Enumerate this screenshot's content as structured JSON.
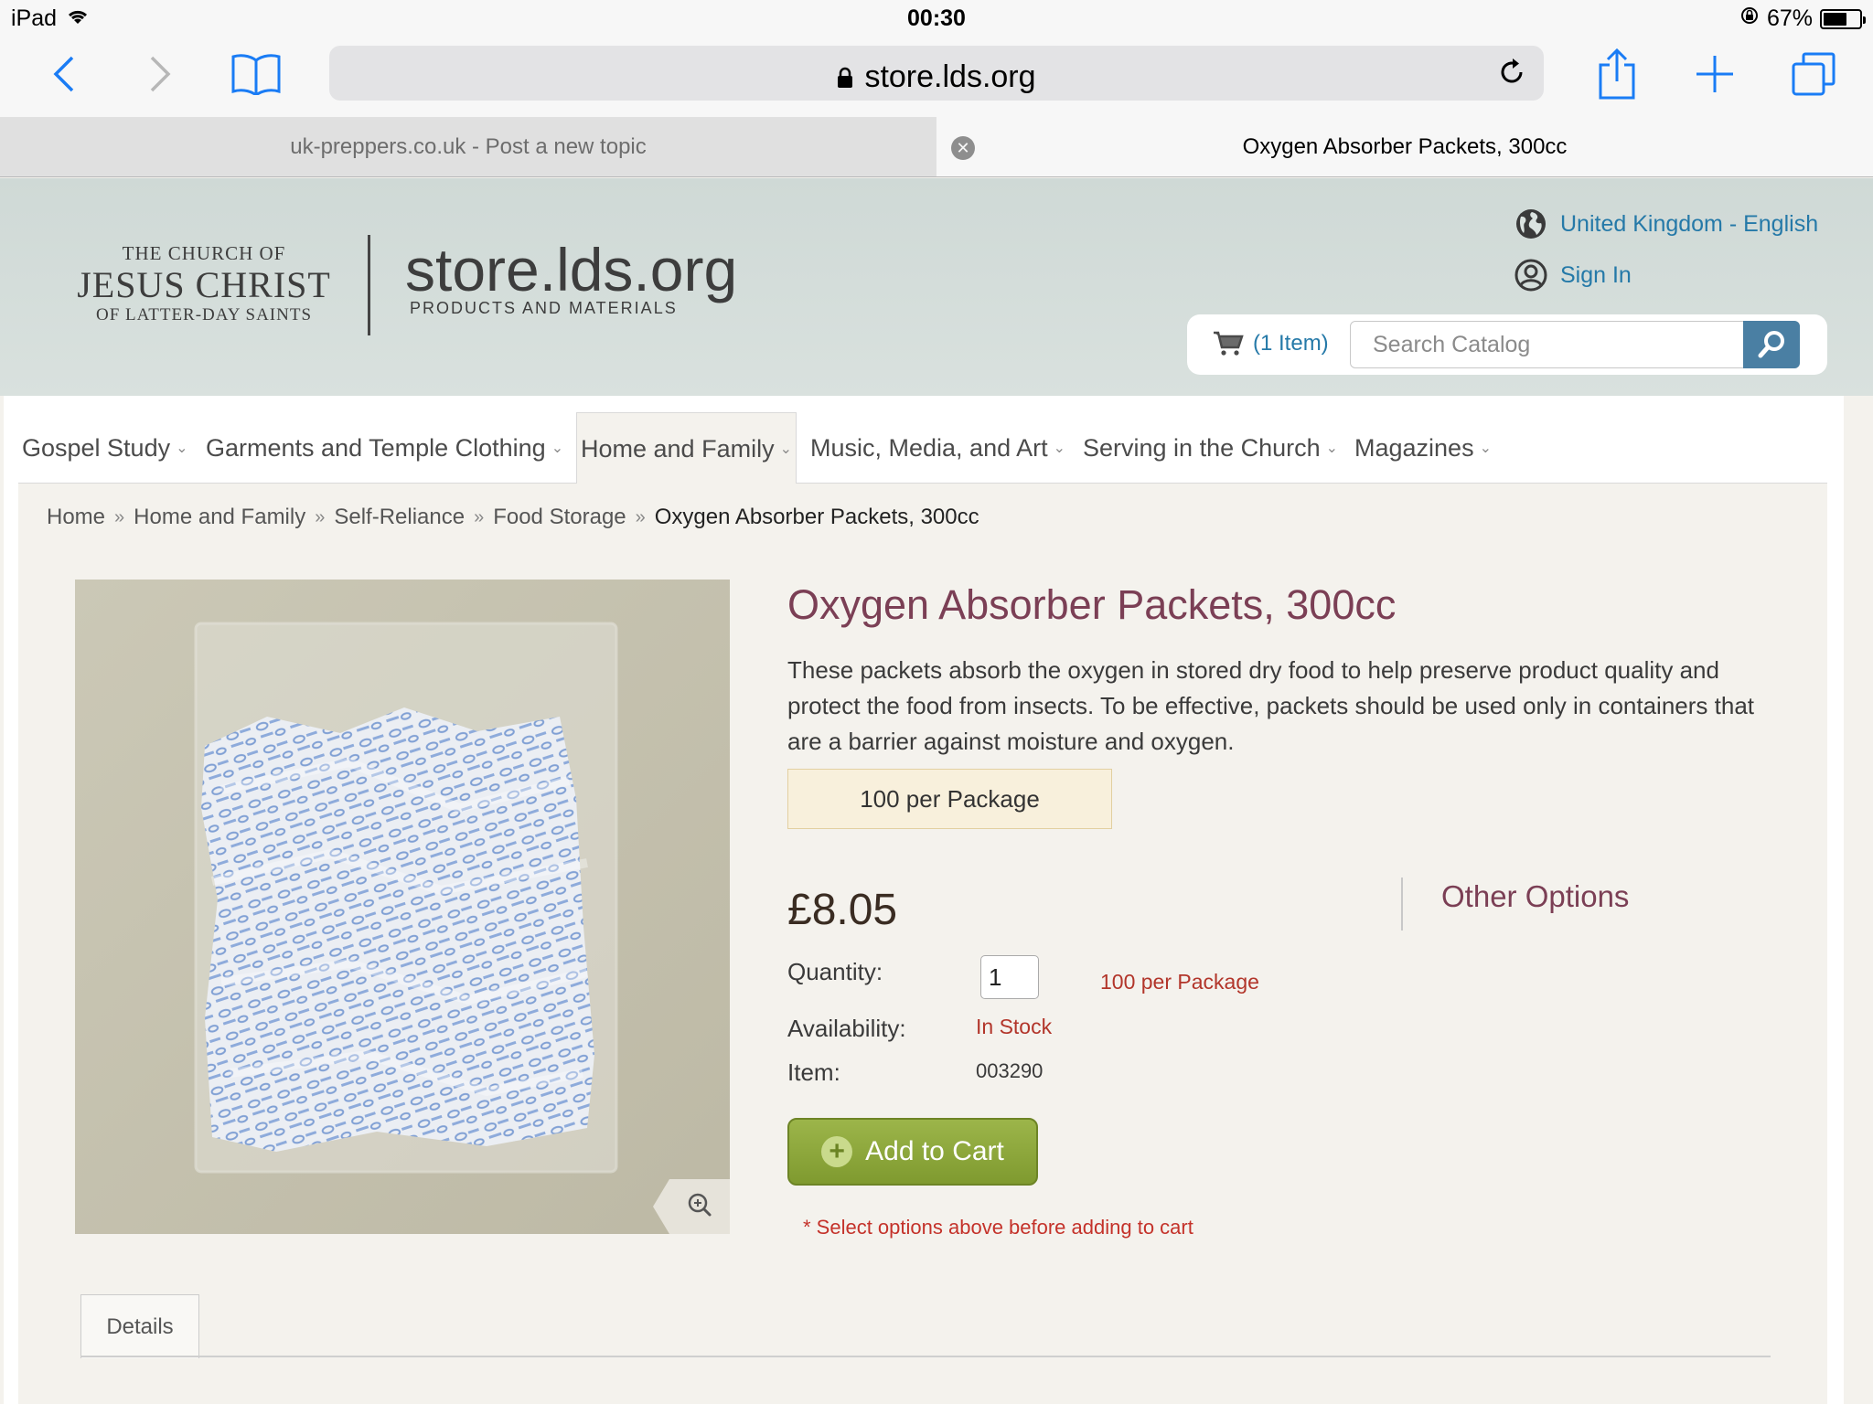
{
  "status_bar": {
    "device": "iPad",
    "time": "00:30",
    "battery": "67%",
    "battery_level": 0.67
  },
  "browser": {
    "url": "store.lds.org",
    "tabs": [
      {
        "title": "uk-preppers.co.uk - Post a new topic"
      },
      {
        "title": "Oxygen Absorber Packets, 300cc"
      }
    ]
  },
  "header": {
    "logo": {
      "line1": "THE CHURCH OF",
      "line2": "JESUS CHRIST",
      "line3": "OF LATTER-DAY SAINTS"
    },
    "store_name": "store.lds.org",
    "store_subtitle": "PRODUCTS AND MATERIALS",
    "locale": "United Kingdom - English",
    "sign_in": "Sign In",
    "cart": "(1 Item)",
    "search_placeholder": "Search Catalog"
  },
  "nav": {
    "items": [
      {
        "label": "Gospel Study"
      },
      {
        "label": "Garments and Temple Clothing"
      },
      {
        "label": "Home and Family"
      },
      {
        "label": "Music, Media, and Art"
      },
      {
        "label": "Serving in the Church"
      },
      {
        "label": "Magazines"
      }
    ]
  },
  "breadcrumb": [
    "Home",
    "Home and Family",
    "Self-Reliance",
    "Food Storage",
    "Oxygen Absorber Packets, 300cc"
  ],
  "product": {
    "title": "Oxygen Absorber Packets, 300cc",
    "description": "These packets absorb the oxygen in stored dry food to help preserve product quality and protect the food from insects. To be effective, packets should be used only in containers that are a barrier against moisture and oxygen.",
    "option": "100 per Package",
    "price": "£8.05",
    "quantity_label": "Quantity:",
    "quantity_value": "1",
    "package_note": "100 per Package",
    "availability_label": "Availability:",
    "availability": "In Stock",
    "item_label": "Item:",
    "item_number": "003290",
    "add_to_cart": "Add to Cart",
    "warning": "* Select options above before adding to cart",
    "other_options": "Other Options",
    "details_tab": "Details"
  },
  "colors": {
    "link_blue": "#2579a8",
    "title_plum": "#7b3f55",
    "alert_red": "#b2352a",
    "cart_green": "#8aa53a"
  }
}
